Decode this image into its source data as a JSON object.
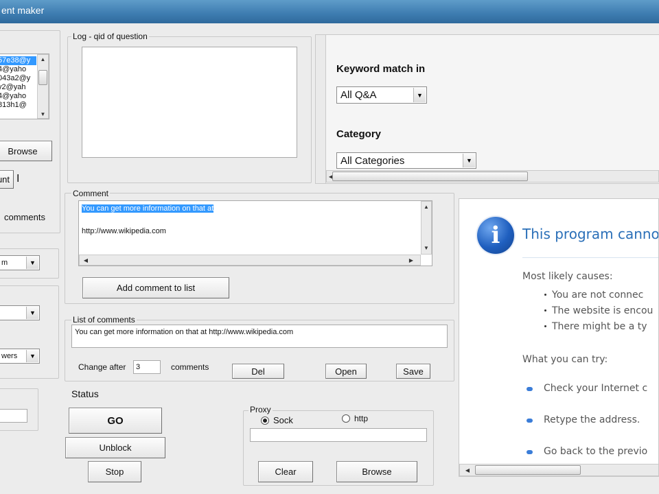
{
  "window": {
    "title": "ent maker"
  },
  "accounts": {
    "items": [
      "57e38@y",
      "4@yaho",
      "043a2@y",
      "y2@yah",
      "4@yaho",
      "813h1@"
    ],
    "selected_index": 0,
    "browse_label": "Browse",
    "count_label": "unt",
    "comments_label": "comments"
  },
  "left": {
    "dropdown1": "m",
    "dropdown2": "",
    "dropdown3": "wers"
  },
  "log": {
    "legend": "Log - qid of question"
  },
  "search": {
    "keyword_label": "Keyword match in",
    "keyword_value": "All Q&A",
    "category_label": "Category",
    "category_value": "All Categories"
  },
  "comment": {
    "legend": "Comment",
    "line1": "You can get more information on that at",
    "line2": "http://www.wikipedia.com",
    "add_button": "Add comment to list"
  },
  "comments_list": {
    "legend": "List of comments",
    "item": "You can get more information on that at http://www.wikipedia.com",
    "change_after_label": "Change after",
    "change_after_value": "3",
    "comments_suffix": "comments",
    "del_button": "Del",
    "open_button": "Open",
    "save_button": "Save"
  },
  "status": {
    "label": "Status",
    "go_button": "GO",
    "unblock_button": "Unblock",
    "stop_button": "Stop"
  },
  "proxy": {
    "legend": "Proxy",
    "sock_label": "Sock",
    "http_label": "http",
    "selected": "Sock",
    "clear_button": "Clear",
    "browse_button": "Browse"
  },
  "ie_error": {
    "title": "This program cannot",
    "causes_heading": "Most likely causes:",
    "causes": [
      "You are not connec",
      "The website is encou",
      "There might be a ty"
    ],
    "try_heading": "What you can try:",
    "actions": [
      "Check your Internet c",
      "Retype the address.",
      "Go back to the previo"
    ]
  },
  "colors": {
    "selection": "#3399ff",
    "ie_title": "#2a6fb8",
    "titlebar": "#3d7cb0"
  }
}
